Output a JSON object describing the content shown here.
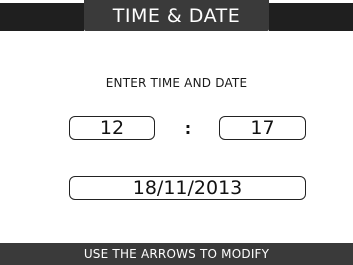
{
  "header": {
    "title": "TIME & DATE"
  },
  "main": {
    "instruction": "ENTER TIME AND DATE",
    "time": {
      "hour": "12",
      "separator": ":",
      "minute": "17"
    },
    "date": "18/11/2013"
  },
  "footer": {
    "hint": "USE THE ARROWS TO MODIFY"
  },
  "colors": {
    "title_bg": "#3a3a3a",
    "bar_bg": "#1f1f1f",
    "footer_bg": "#3a3a3a",
    "text": "#111111",
    "background": "#ffffff"
  }
}
